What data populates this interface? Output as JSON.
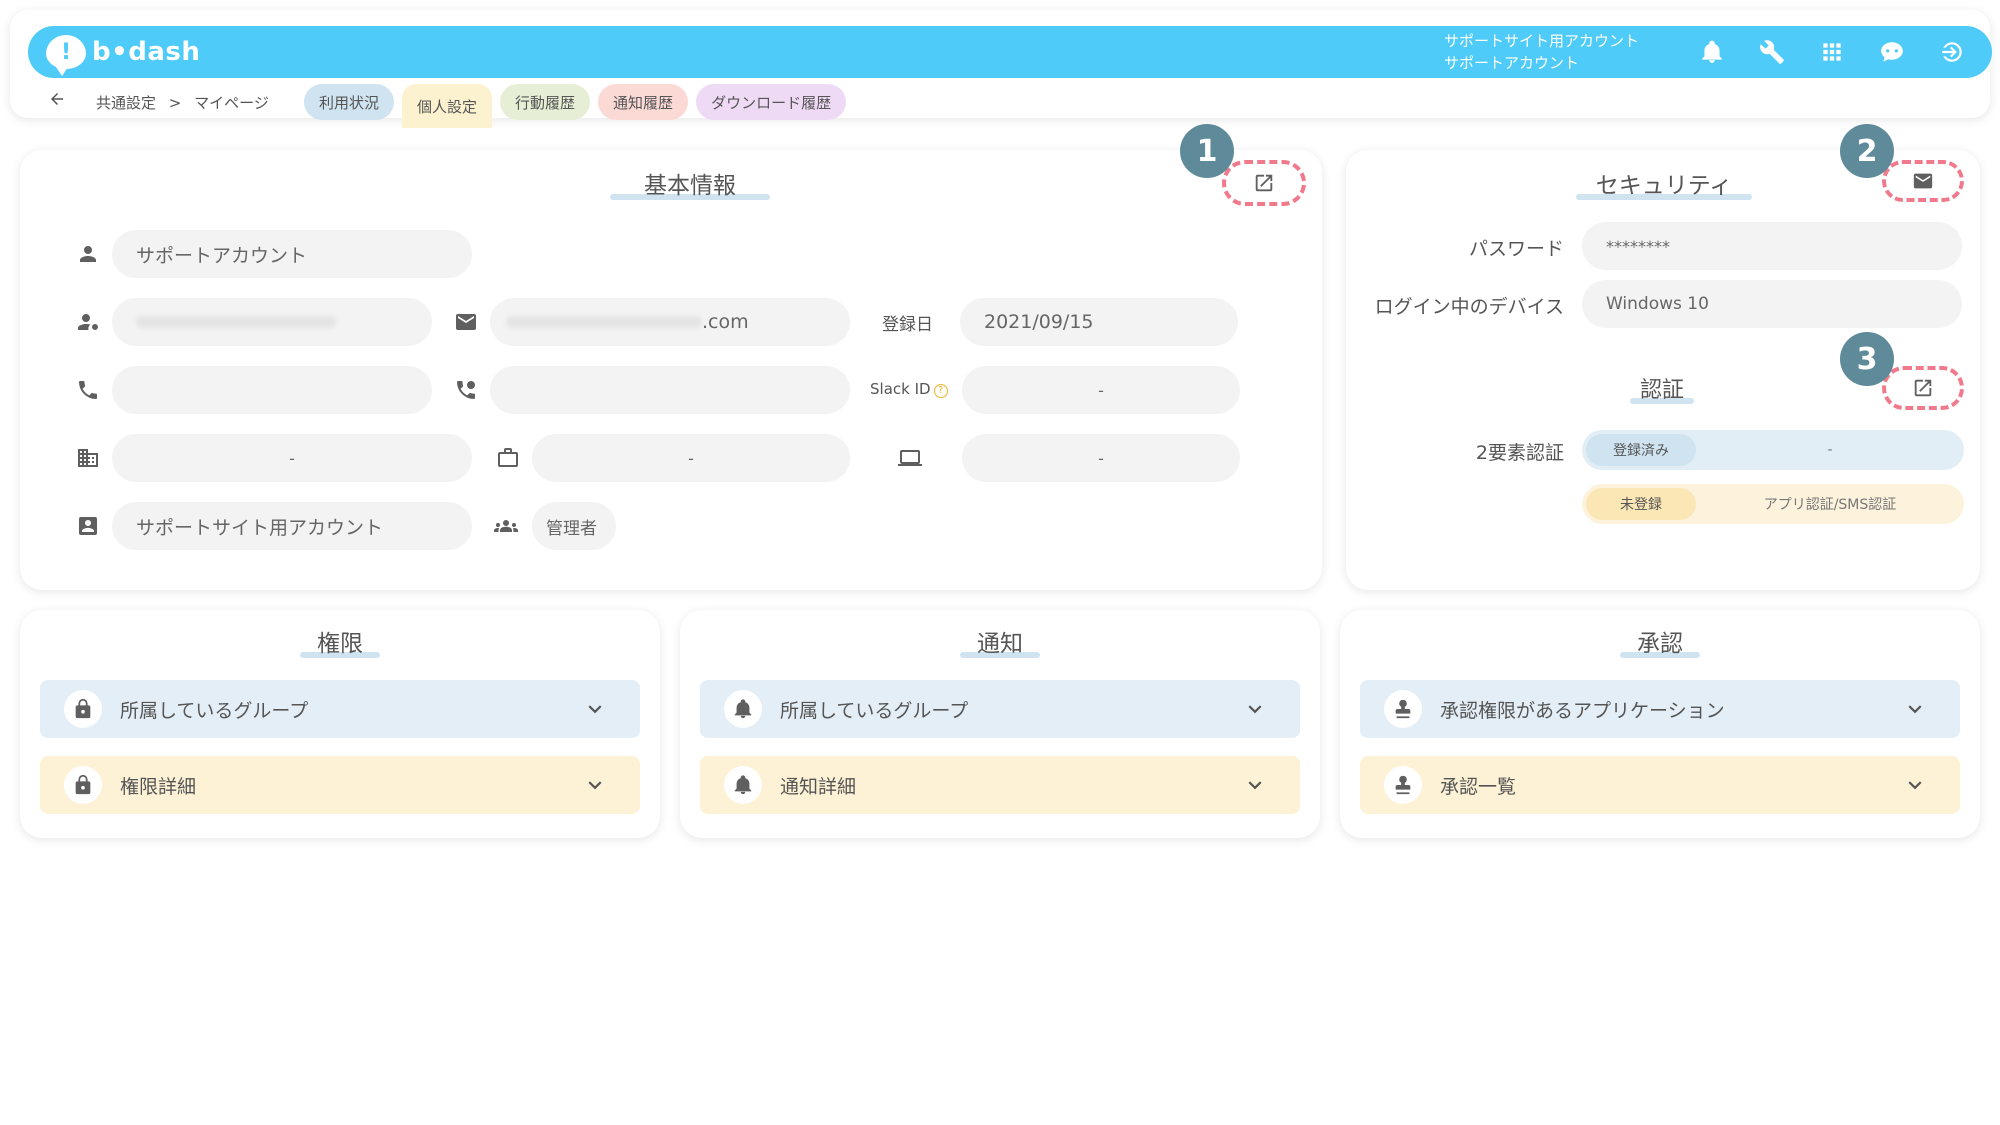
{
  "header": {
    "logo_text": "b•dash",
    "user_line1": "サポートサイト用アカウント",
    "user_line2": "サポートアカウント",
    "icons": [
      "bell-icon",
      "wrench-icon",
      "apps-grid-icon",
      "chat-bot-icon",
      "logout-icon"
    ]
  },
  "subnav": {
    "breadcrumb": [
      "共通設定",
      ">",
      "マイページ"
    ],
    "tabs": [
      {
        "label": "利用状況",
        "color": "#cfe3f0"
      },
      {
        "label": "個人設定",
        "color": "#fdf2cf",
        "active": true
      },
      {
        "label": "行動履歴",
        "color": "#e6efd6"
      },
      {
        "label": "通知履歴",
        "color": "#fbdad6"
      },
      {
        "label": "ダウンロード履歴",
        "color": "#efdaf5"
      }
    ]
  },
  "basic_info": {
    "title": "基本情報",
    "name": "サポートアカウント",
    "email_suffix": ".com",
    "reg_date_label": "登録日",
    "reg_date": "2021/09/15",
    "slack_label": "Slack ID",
    "slack_value": "-",
    "company_value": "-",
    "department_value": "-",
    "device_value": "-",
    "account_name": "サポートサイト用アカウント",
    "role": "管理者",
    "badge": "1"
  },
  "security": {
    "title": "セキュリティ",
    "password_label": "パスワード",
    "password_value": "********",
    "device_label": "ログイン中のデバイス",
    "device_value": "Windows 10",
    "badge": "2",
    "auth_title": "認証",
    "auth_badge": "3",
    "twofa_label": "2要素認証",
    "twofa_rows": [
      {
        "status": "登録済み",
        "value": "-",
        "bg": "#e1eef6",
        "status_bg": "#cfe3f0"
      },
      {
        "status": "未登録",
        "value": "アプリ認証/SMS認証",
        "bg": "#fdf3dc",
        "status_bg": "#fbe6b5"
      }
    ]
  },
  "permissions": {
    "title": "権限",
    "items": [
      {
        "label": "所属しているグループ",
        "bg": "#e3eef6"
      },
      {
        "label": "権限詳細",
        "bg": "#fdf2d5"
      }
    ]
  },
  "notifications": {
    "title": "通知",
    "items": [
      {
        "label": "所属しているグループ",
        "bg": "#e3eef6"
      },
      {
        "label": "通知詳細",
        "bg": "#fdf2d5"
      }
    ]
  },
  "approval": {
    "title": "承認",
    "items": [
      {
        "label": "承認権限があるアプリケーション",
        "bg": "#e3eef6"
      },
      {
        "label": "承認一覧",
        "bg": "#fdf2d5"
      }
    ]
  }
}
